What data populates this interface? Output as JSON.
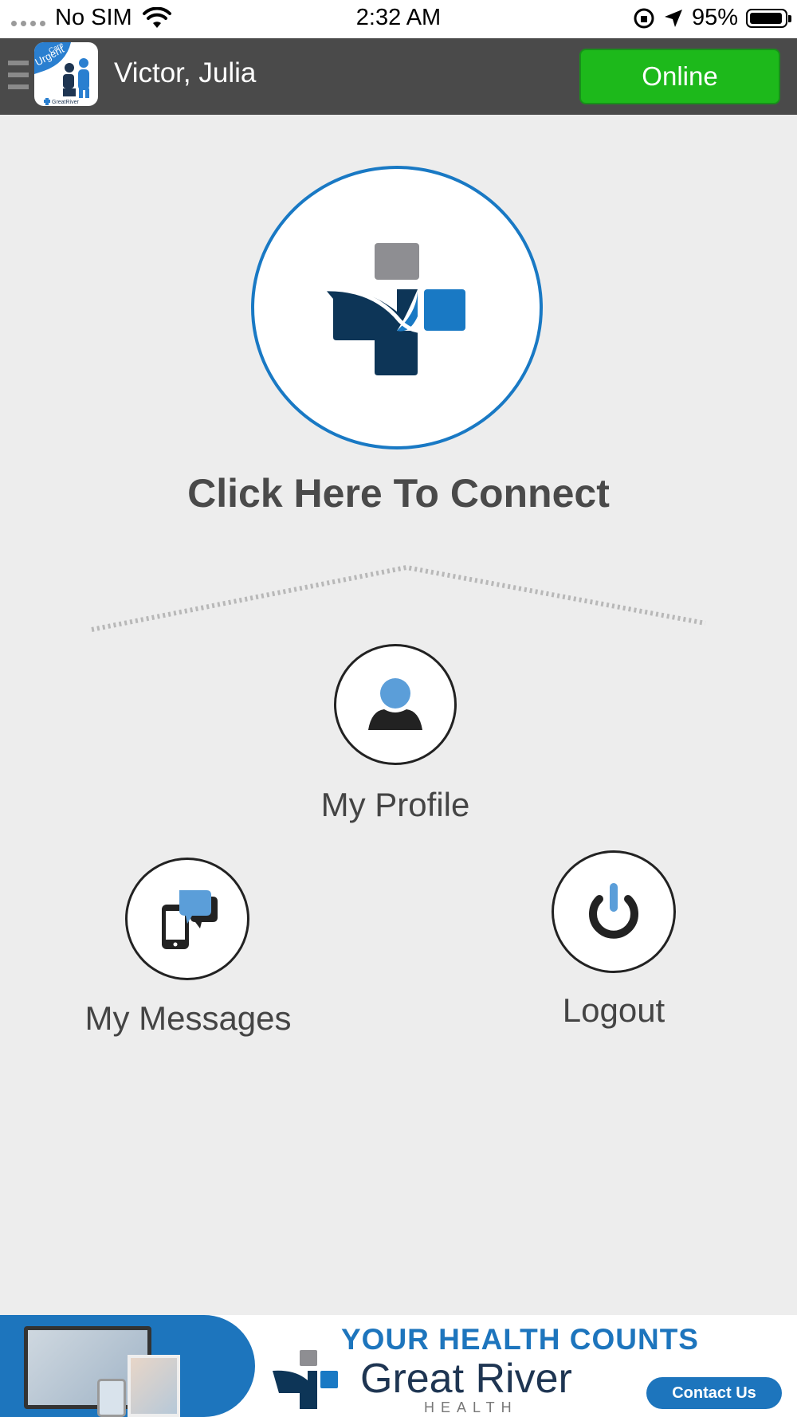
{
  "status_bar": {
    "carrier": "No SIM",
    "time": "2:32 AM",
    "battery": "95%",
    "battery_level": 0.95
  },
  "header": {
    "user_name": "Victor, Julia",
    "status_button": "Online",
    "logo_text": [
      "Care",
      "Urgent",
      "GreatRiver"
    ],
    "colors": {
      "bar": "#4a4a4a",
      "online": "#1db91b"
    }
  },
  "main": {
    "connect_label": "Click Here To Connect",
    "connect_icon": "medical-cross-icon",
    "profile_label": "My Profile",
    "profile_icon": "person-icon",
    "messages_label": "My Messages",
    "messages_icon": "phone-chat-icon",
    "logout_label": "Logout",
    "logout_icon": "power-icon",
    "colors": {
      "accent_blue": "#1979c4",
      "dark_navy": "#0d3557"
    }
  },
  "banner": {
    "headline": "YOUR HEALTH COUNTS",
    "brand": "Great River",
    "brand_sub": "HEALTH",
    "contact_button": "Contact Us"
  }
}
